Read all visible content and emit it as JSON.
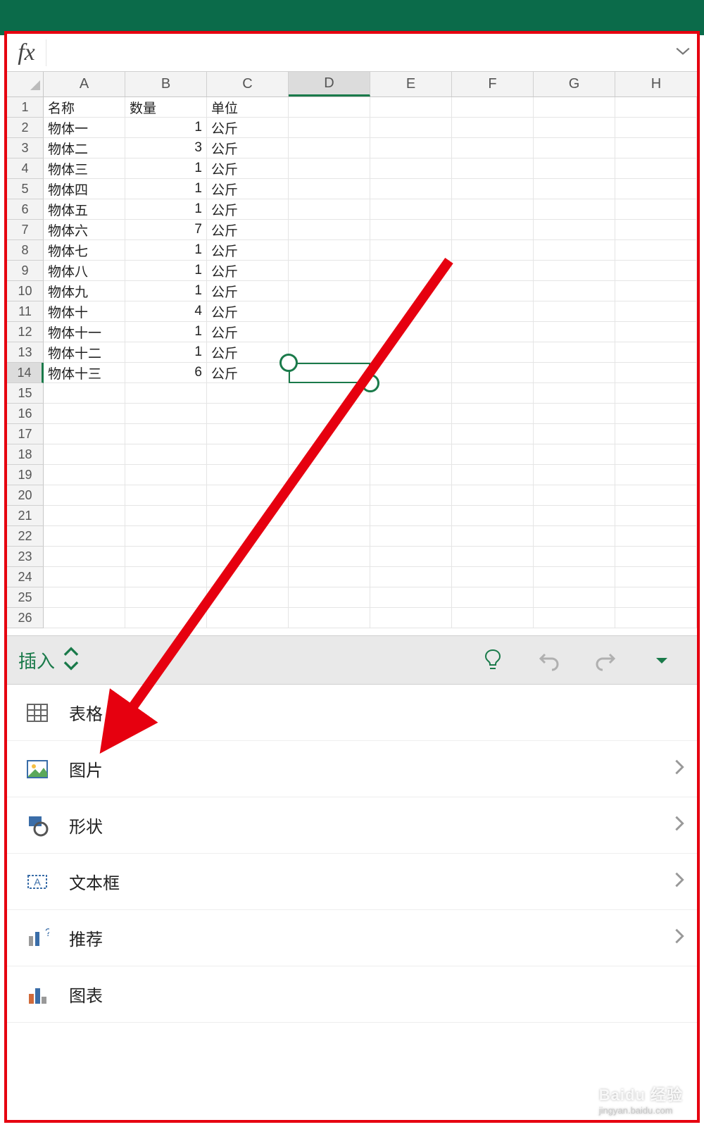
{
  "formula_bar": {
    "fx_label": "fx",
    "value": ""
  },
  "columns": [
    "A",
    "B",
    "C",
    "D",
    "E",
    "F",
    "G",
    "H"
  ],
  "selected_column_index": 3,
  "selected_row_index": 13,
  "selected_cell": "D14",
  "row_count": 26,
  "sheet_rows": [
    {
      "a": "名称",
      "b": "数量",
      "c": "单位"
    },
    {
      "a": "物体一",
      "b": 1,
      "c": "公斤"
    },
    {
      "a": "物体二",
      "b": 3,
      "c": "公斤"
    },
    {
      "a": "物体三",
      "b": 1,
      "c": "公斤"
    },
    {
      "a": "物体四",
      "b": 1,
      "c": "公斤"
    },
    {
      "a": "物体五",
      "b": 1,
      "c": "公斤"
    },
    {
      "a": "物体六",
      "b": 7,
      "c": "公斤"
    },
    {
      "a": "物体七",
      "b": 1,
      "c": "公斤"
    },
    {
      "a": "物体八",
      "b": 1,
      "c": "公斤"
    },
    {
      "a": "物体九",
      "b": 1,
      "c": "公斤"
    },
    {
      "a": "物体十",
      "b": 4,
      "c": "公斤"
    },
    {
      "a": "物体十一",
      "b": 1,
      "c": "公斤"
    },
    {
      "a": "物体十二",
      "b": 1,
      "c": "公斤"
    },
    {
      "a": "物体十三",
      "b": 6,
      "c": "公斤"
    }
  ],
  "tab": {
    "name": "插入"
  },
  "menu_items": [
    {
      "icon": "table-icon",
      "label": "表格",
      "chevron": false
    },
    {
      "icon": "picture-icon",
      "label": "图片",
      "chevron": true
    },
    {
      "icon": "shape-icon",
      "label": "形状",
      "chevron": true
    },
    {
      "icon": "textbox-icon",
      "label": "文本框",
      "chevron": true
    },
    {
      "icon": "recommend-icon",
      "label": "推荐",
      "chevron": true
    },
    {
      "icon": "chart-icon",
      "label": "图表",
      "chevron": false
    }
  ],
  "colors": {
    "accent": "#1a7a4a",
    "red": "#e6000f"
  },
  "watermark": {
    "brand": "Baidu 经验",
    "url": "jingyan.baidu.com"
  }
}
